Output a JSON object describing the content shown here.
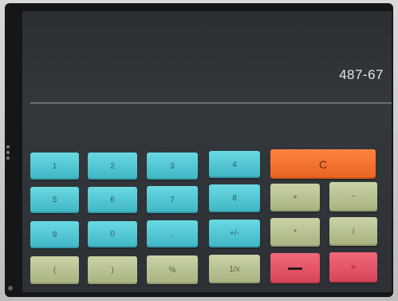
{
  "display": {
    "value": "487-67"
  },
  "keys": {
    "k1": "1",
    "k2": "2",
    "k3": "3",
    "k4": "4",
    "k5": "5",
    "k6": "6",
    "k7": "7",
    "k8": "8",
    "k9": "9",
    "k0": "0",
    "kdot": ".",
    "kneg": "+/-",
    "klp": "(",
    "krp": ")",
    "kpct": "%",
    "kinv": "1/x",
    "kclear": "C",
    "kplus": "+",
    "kminus": "−",
    "kmul": "*",
    "kdiv": "/",
    "keq": "="
  },
  "icons": {
    "backspace": "backspace-icon"
  },
  "colors": {
    "digit_key": "#4fc3d0",
    "operator_key": "#b8c28f",
    "clear_key": "#f47330",
    "action_key": "#e35468",
    "screen_bg": "#30353a"
  }
}
